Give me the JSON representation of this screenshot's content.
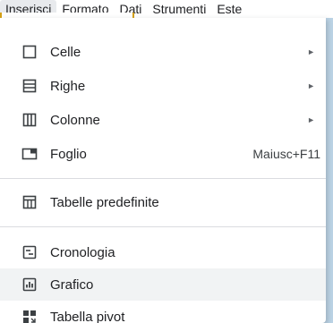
{
  "menubar": {
    "items": [
      {
        "label": "Inserisci",
        "active": true
      },
      {
        "label": "Formato",
        "active": false
      },
      {
        "label": "Dati",
        "active": false
      },
      {
        "label": "Strumenti",
        "active": false
      },
      {
        "label": "Este",
        "active": false
      }
    ]
  },
  "menu": {
    "items": [
      {
        "label": "Celle",
        "icon": "cell-icon",
        "submenu": true
      },
      {
        "label": "Righe",
        "icon": "rows-icon",
        "submenu": true
      },
      {
        "label": "Colonne",
        "icon": "columns-icon",
        "submenu": true
      },
      {
        "label": "Foglio",
        "icon": "sheet-icon",
        "shortcut": "Maiusc+F11"
      },
      {
        "label": "Tabelle predefinite",
        "icon": "table-icon"
      },
      {
        "label": "Cronologia",
        "icon": "timeline-icon"
      },
      {
        "label": "Grafico",
        "icon": "chart-icon",
        "hovered": true
      },
      {
        "label": "Tabella pivot",
        "icon": "pivot-table-icon"
      }
    ],
    "submenu_arrow": "►"
  },
  "colors": {
    "menu_bg": "#ffffff",
    "hover_bg": "#f1f3f4",
    "divider": "#dadce0",
    "text": "#202124",
    "background": "#bcd4e6"
  }
}
